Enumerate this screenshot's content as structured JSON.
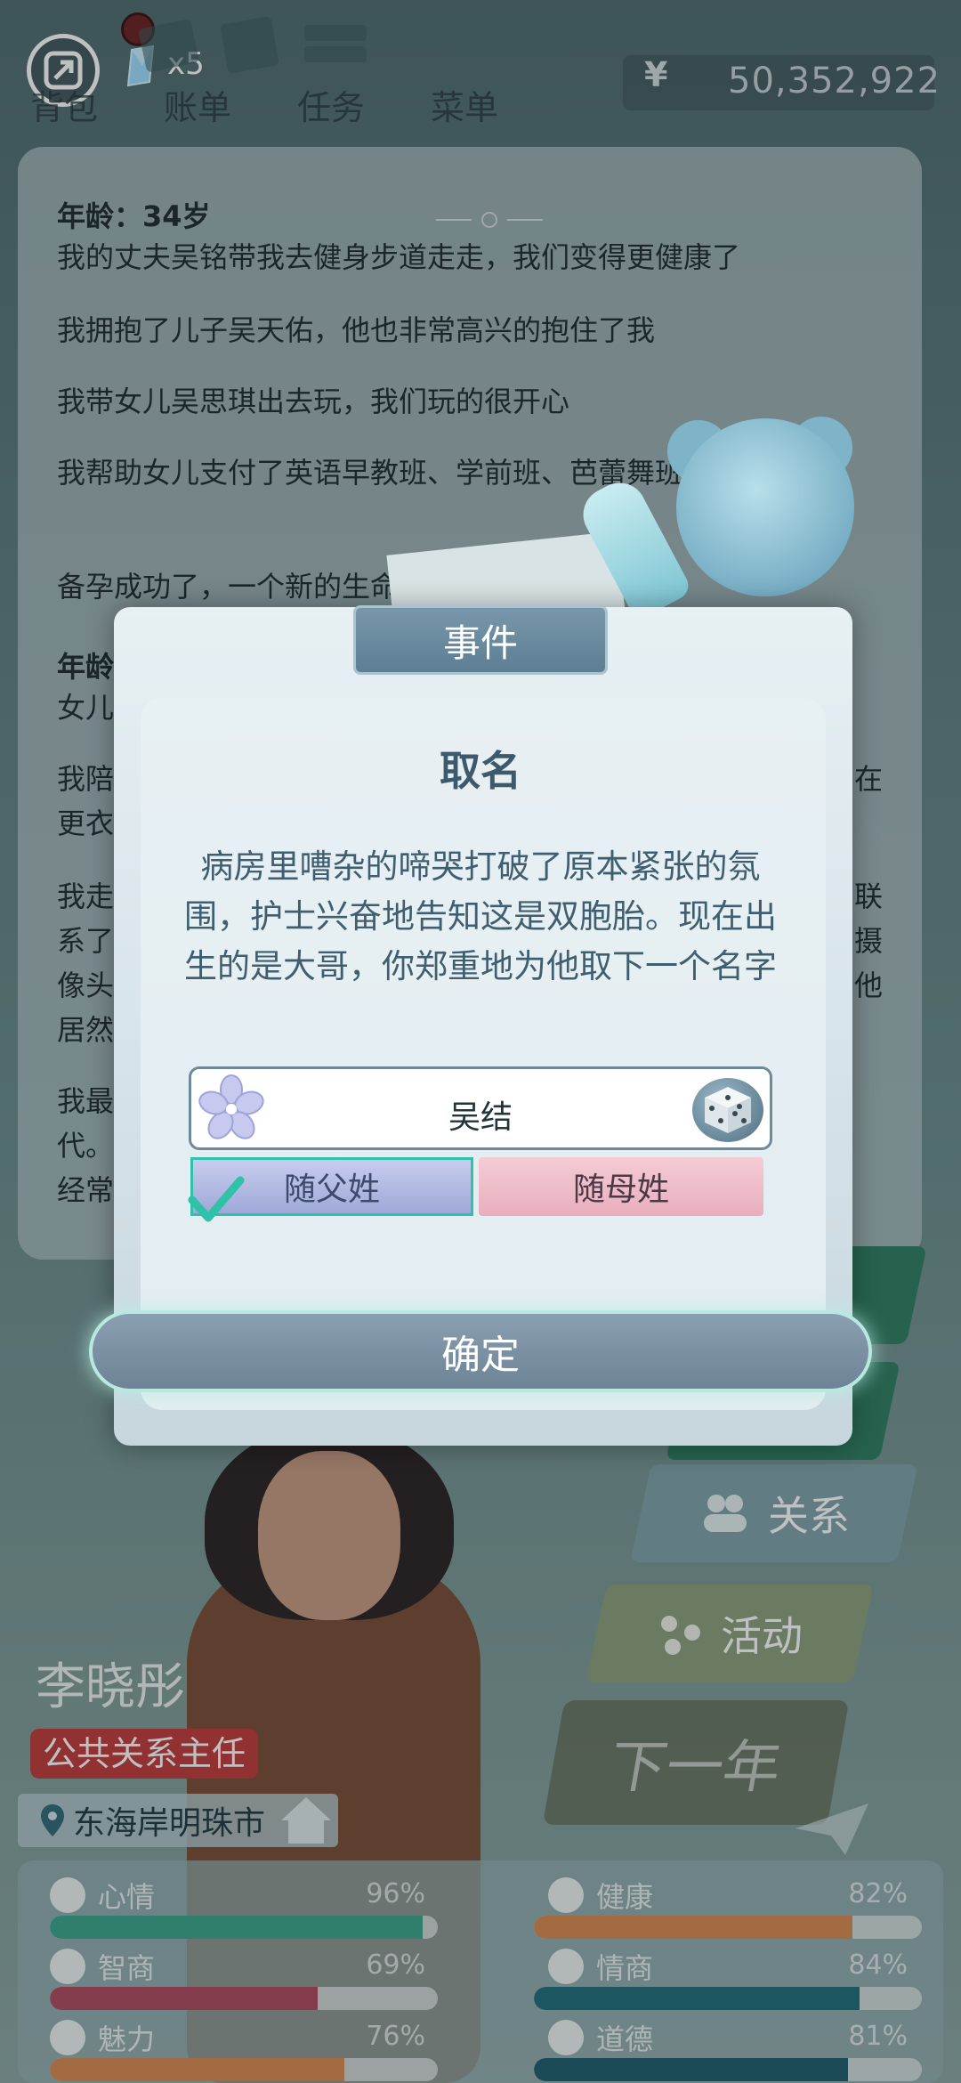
{
  "topbar": {
    "gem_count": "x5",
    "tabs": [
      "背包",
      "账单",
      "任务",
      "菜单"
    ],
    "money_symbol": "¥",
    "money": "50,352,922"
  },
  "log": {
    "heading1": "年龄：34岁",
    "entries1": [
      "我的丈夫吴铭带我去健身步道走走，我们变得更健康了",
      "我拥抱了儿子吴天佑，他也非常高兴的抱住了我",
      "我带女儿吴思琪出去玩，我们玩的很开心",
      "我帮助女儿支付了英语早教班、学前班、芭蕾舞班的费用",
      "备孕成功了，一个新的生命"
    ],
    "heading2": "年龄",
    "entry2": "女儿",
    "partial_lines": [
      "我陪",
      "更衣",
      "我走",
      "系了",
      "像头",
      "居然",
      "我最",
      "代。",
      "经常"
    ],
    "partial_right": [
      "在",
      "联",
      "摄",
      "他"
    ]
  },
  "side_buttons": {
    "relation": "关系",
    "activity": "活动",
    "next_year": "下一年"
  },
  "character": {
    "name": "李晓彤",
    "job": "公共关系主任",
    "city": "东海岸明珠市"
  },
  "stats": [
    {
      "label": "心情",
      "value": "96%",
      "fill": 0.96,
      "color": "#3aa589"
    },
    {
      "label": "健康",
      "value": "82%",
      "fill": 0.82,
      "color": "#d98a50"
    },
    {
      "label": "智商",
      "value": "69%",
      "fill": 0.69,
      "color": "#b0485f"
    },
    {
      "label": "情商",
      "value": "84%",
      "fill": 0.84,
      "color": "#1f6d7a"
    },
    {
      "label": "魅力",
      "value": "76%",
      "fill": 0.76,
      "color": "#d98a50"
    },
    {
      "label": "道德",
      "value": "81%",
      "fill": 0.81,
      "color": "#1f5d6e"
    }
  ],
  "modal": {
    "tab": "事件",
    "title": "取名",
    "description": "病房里嘈杂的啼哭打破了原本紧张的氛围，护士兴奋地告知这是双胞胎。现在出生的是大哥，你郑重地为他取下一个名字",
    "name_value": "吴结",
    "surname_father": "随父姓",
    "surname_mother": "随母姓",
    "confirm": "确定",
    "selected": "随父姓"
  }
}
